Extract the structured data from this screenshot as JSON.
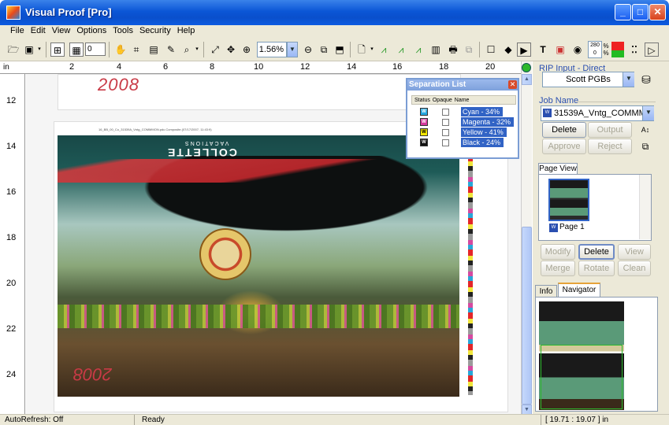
{
  "window": {
    "title": "Visual Proof [Pro]"
  },
  "menu": [
    "File",
    "Edit",
    "View",
    "Options",
    "Tools",
    "Security",
    "Help"
  ],
  "toolbar": {
    "zoom_value": "1.56%",
    "page_field": "0",
    "tint_top": "280",
    "tint_bottom": "0"
  },
  "rulers": {
    "unit": "in",
    "top_ticks": [
      "2",
      "4",
      "6",
      "8",
      "10",
      "12",
      "14",
      "16",
      "18",
      "20"
    ],
    "left_ticks": [
      "12",
      "14",
      "16",
      "18",
      "20",
      "22",
      "24"
    ]
  },
  "canvas": {
    "slug_text": "16_BB_00_Co_31539A_Vntg_COMMMON.pdc.Composite.(07/17/2007, 11:43:9)",
    "art_brand": "COLLETTE",
    "art_brand_sub": "VACATIONS",
    "art_year": "2008"
  },
  "separation_list": {
    "title": "Separation List",
    "columns": [
      "Status",
      "Opaque",
      "Name"
    ],
    "rows": [
      {
        "name": "Cyan - 34%",
        "color": "#27a9e1"
      },
      {
        "name": "Magenta - 32%",
        "color": "#d53a9d"
      },
      {
        "name": "Yellow - 41%",
        "color": "#f2e600"
      },
      {
        "name": "Black - 24%",
        "color": "#111111"
      }
    ]
  },
  "rip_input": {
    "label": "RIP Input - Direct",
    "value": "Scott PGBs"
  },
  "job_name": {
    "label": "Job Name",
    "value": "31539A_Vntg_COMMMON.pc",
    "buttons": {
      "delete": "Delete",
      "output": "Output",
      "approve": "Approve",
      "reject": "Reject"
    }
  },
  "page_view": {
    "tab": "Page View",
    "page_label": "Page 1",
    "buttons": {
      "modify": "Modify",
      "delete": "Delete",
      "view": "View",
      "merge": "Merge",
      "rotate": "Rotate",
      "clean": "Clean"
    }
  },
  "bottom_tabs": {
    "info": "Info",
    "navigator": "Navigator"
  },
  "status": {
    "autorefresh": "AutoRefresh: Off",
    "state": "Ready",
    "coords": "[ 19.71 : 19.07 ] in"
  },
  "colors": {
    "accent": "#3163c5",
    "title_bar": "#0b56d6"
  }
}
